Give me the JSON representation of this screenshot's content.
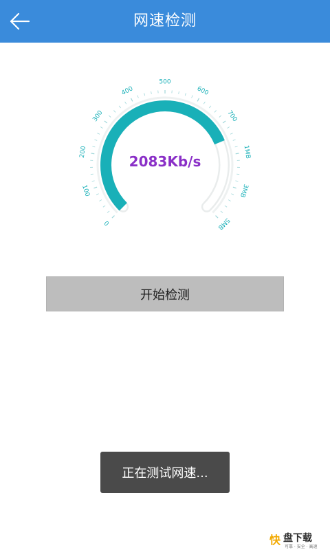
{
  "header": {
    "title": "网速检测",
    "back_icon": "arrow-left-icon",
    "background": "#3a8bdb"
  },
  "gauge": {
    "speed_text": "2083Kb/s",
    "speed_color": "#8a2fc7",
    "arc_color": "#19b0b8",
    "track_color": "#e9ecec",
    "tick_labels": [
      "0",
      "100",
      "200",
      "300",
      "400",
      "500",
      "600",
      "700",
      "1MB",
      "3MB",
      "5MB"
    ],
    "progress_fraction": 0.75
  },
  "actions": {
    "start_label": "开始检测"
  },
  "toast": {
    "message": "正在测试网速..."
  },
  "watermark": {
    "logo_char": "快",
    "brand": "盘下载",
    "tagline": "可靠 · 安全 · 高速"
  }
}
